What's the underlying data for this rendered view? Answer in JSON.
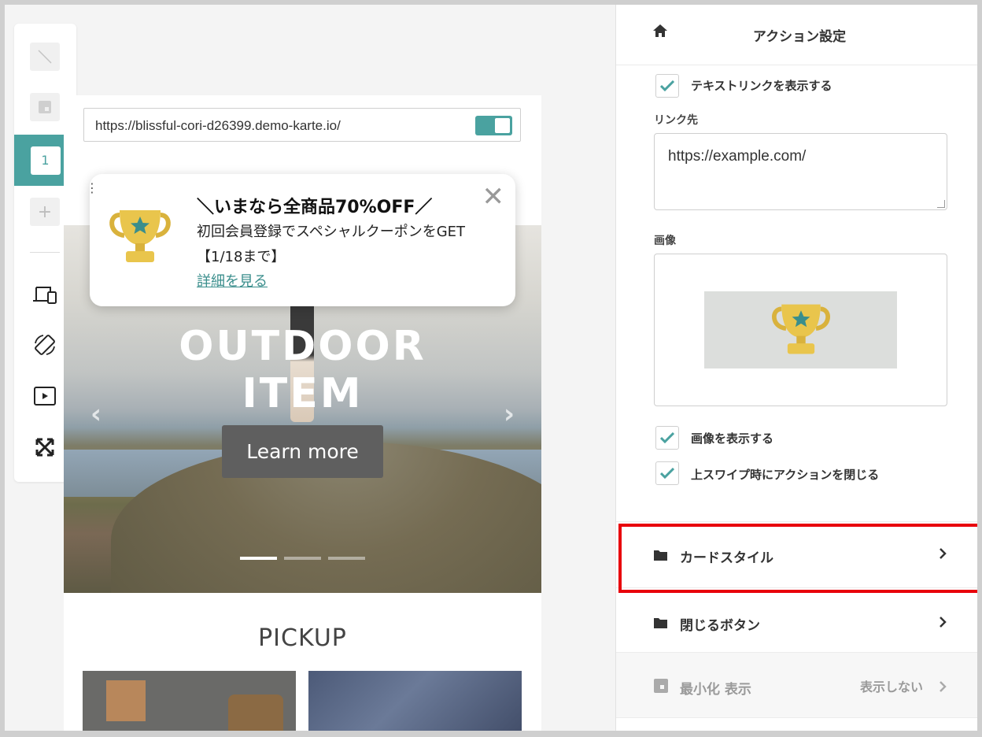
{
  "preview": {
    "url": "https://blissful-cori-d26399.demo-karte.io/",
    "hero_title_line1": "OUTDOOR",
    "hero_title_line2": "ITEM",
    "hero_button": "Learn more",
    "pickup_heading": "PICKUP",
    "slide_count": 3,
    "active_slide": 1
  },
  "toolbar": {
    "active_page": "1",
    "add_label": "+"
  },
  "popup": {
    "title": "＼いまなら全商品70%OFF／",
    "line1": "初回会員登録でスペシャルクーポンをGET",
    "line2": "【1/18まで】",
    "link": "詳細を見る",
    "close": "✕"
  },
  "panel": {
    "title": "アクション設定",
    "show_text_link": {
      "label": "テキストリンクを表示する",
      "checked": true
    },
    "link_label": "リンク先",
    "link_value": "https://example.com/",
    "image_label": "画像",
    "show_image": {
      "label": "画像を表示する",
      "checked": true
    },
    "swipe_close": {
      "label": "上スワイプ時にアクションを閉じる",
      "checked": true
    },
    "sections": [
      {
        "label": "カードスタイル",
        "icon": "folder-icon"
      },
      {
        "label": "閉じるボタン",
        "icon": "folder-icon"
      }
    ],
    "minimize": {
      "label": "最小化 表示",
      "value": "表示しない"
    }
  },
  "colors": {
    "accent": "#4aa2a0",
    "highlight": "#e8000b",
    "link": "#3a8e8c"
  }
}
